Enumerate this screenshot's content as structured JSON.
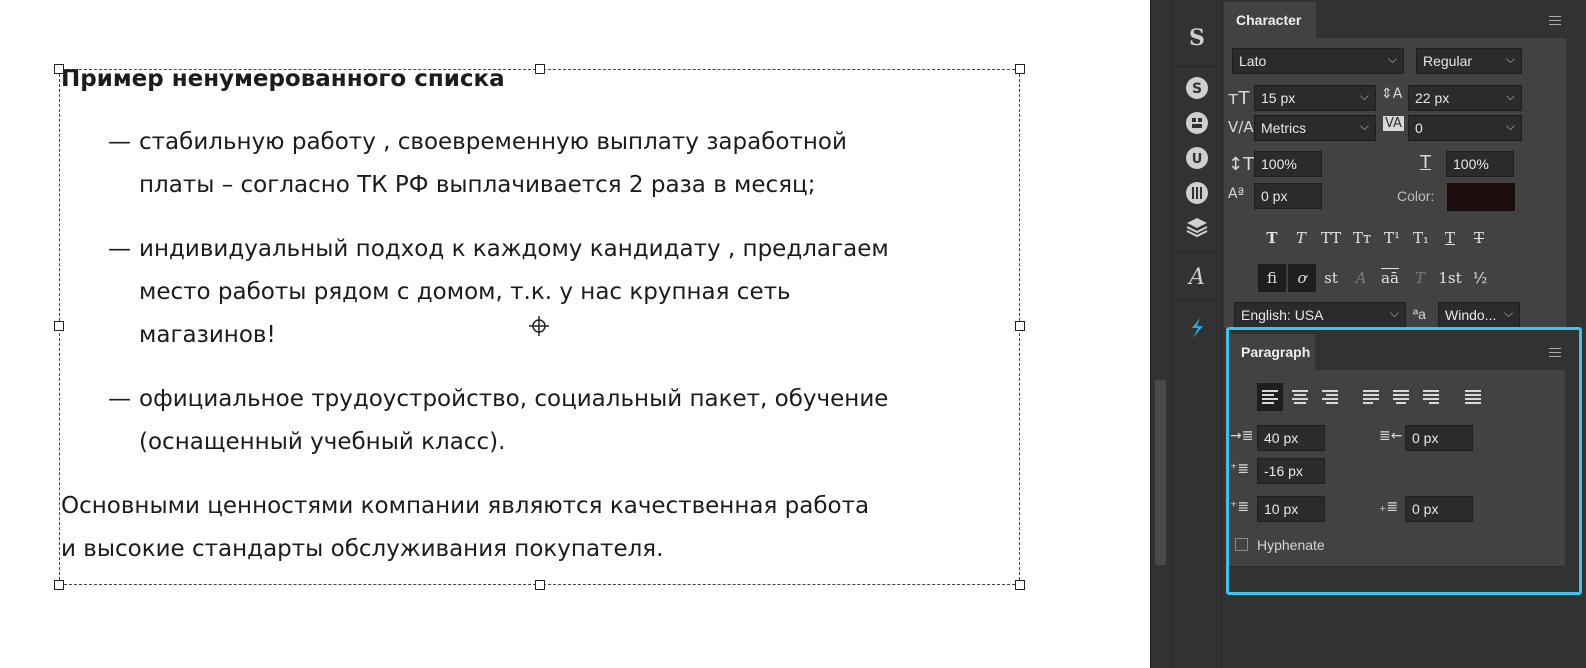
{
  "document": {
    "title": "Пример ненумерованного списка",
    "bullet": "—",
    "items": [
      [
        "стабильную работу , своевременную выплату заработной",
        "платы – согласно ТК РФ выплачивается 2 раза в месяц;"
      ],
      [
        "индивидуальный подход к каждому кандидату , предлагаем",
        "место работы рядом с домом, т.к. у нас крупная сеть",
        "магазинов!"
      ],
      [
        "официальное трудоустройство, социальный пакет, обучение",
        "(оснащенный учебный класс)."
      ]
    ],
    "closing": [
      "Основными ценностями компании являются качественная работа",
      "и высокие стандарты обслуживания покупателя."
    ]
  },
  "character": {
    "tab_label": "Character",
    "font_family": "Lato",
    "font_style": "Regular",
    "font_size": "15 px",
    "leading": "22 px",
    "kerning": "Metrics",
    "tracking": "0",
    "vertical_scale": "100%",
    "horizontal_scale": "100%",
    "baseline_shift": "0 px",
    "color_label": "Color:",
    "color_value": "#1e0e0e",
    "style_buttons": [
      "T",
      "T",
      "TT",
      "Tт",
      "T¹",
      "T₁",
      "T",
      "T"
    ],
    "opentype_buttons": [
      "fi",
      "ơ",
      "st",
      "A",
      "aā",
      "T",
      "1st",
      "½"
    ],
    "language": "English: USA",
    "aa_label": "ªa",
    "antialias": "Windo..."
  },
  "paragraph": {
    "tab_label": "Paragraph",
    "indent_left": "40 px",
    "indent_right": "0 px",
    "indent_first_line": "-16 px",
    "space_before": "10 px",
    "space_after": "0 px",
    "hyphenate_label": "Hyphenate"
  },
  "accent_color": "#3fc3ea"
}
